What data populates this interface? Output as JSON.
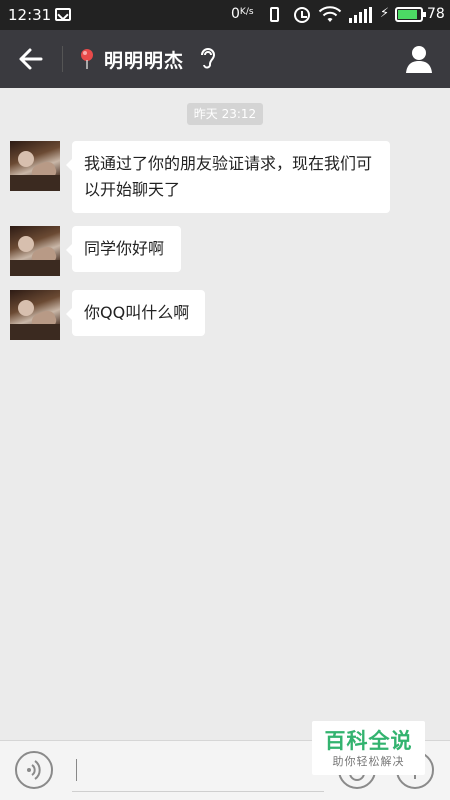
{
  "status_bar": {
    "time": "12:31",
    "net_speed": "0",
    "net_speed_unit": "K/s",
    "battery_percent": "78",
    "battery_level": 0.78,
    "battery_color": "#4cd964"
  },
  "header": {
    "title": "明明明杰",
    "back_icon": "arrow-left-icon",
    "location_icon": "location-pin-icon",
    "earpiece_icon": "earpiece-icon",
    "profile_icon": "person-icon",
    "background": "#3a3a3f"
  },
  "chat": {
    "timestamp": "昨天 23:12",
    "messages": [
      {
        "sender": "incoming",
        "text": "我通过了你的朋友验证请求，现在我们可以开始聊天了"
      },
      {
        "sender": "incoming",
        "text": "同学你好啊"
      },
      {
        "sender": "incoming",
        "text": "你QQ叫什么啊"
      }
    ]
  },
  "input_bar": {
    "voice_icon": "voice-icon",
    "emoji_icon": "emoji-icon",
    "more_icon": "plus-icon",
    "value": ""
  },
  "watermark": {
    "main": "百科全说",
    "sub": "助你轻松解决",
    "color": "#33b36f"
  }
}
